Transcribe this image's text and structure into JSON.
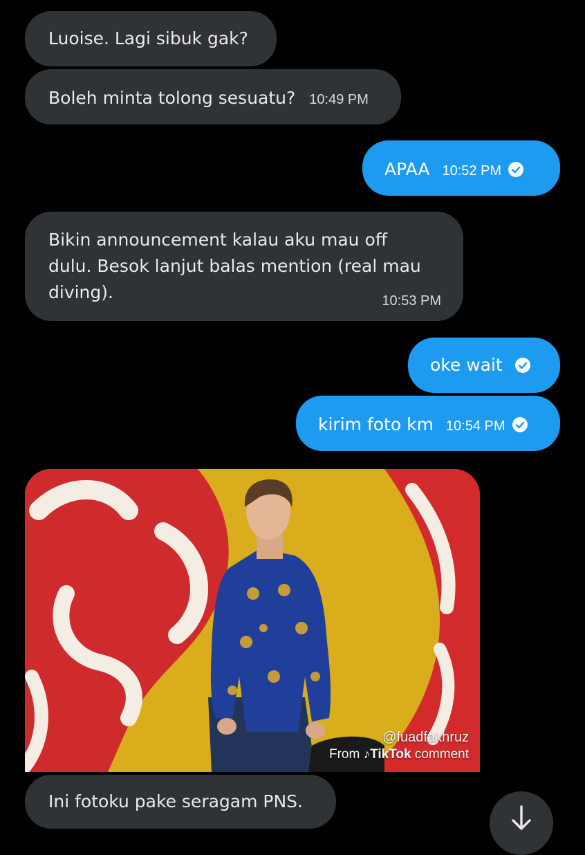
{
  "messages": [
    {
      "dir": "in",
      "text": "Luoise. Lagi sibuk gak?"
    },
    {
      "dir": "in",
      "text": "Boleh minta tolong sesuatu?",
      "time": "10:49 PM"
    },
    {
      "dir": "out",
      "text": "APAA",
      "time": "10:52 PM"
    },
    {
      "dir": "in",
      "lines": [
        "Bikin announcement kalau aku mau off",
        "dulu. Besok lanjut balas mention (real mau",
        "diving)."
      ],
      "time": "10:53 PM"
    },
    {
      "dir": "out",
      "text": "oke wait"
    },
    {
      "dir": "out",
      "text": "kirim foto km",
      "time": "10:54 PM"
    },
    {
      "dir": "in",
      "text": "Ini fotoku pake seragam PNS."
    }
  ],
  "image": {
    "watermark_handle": "@fuadfakhruz",
    "watermark_from": "From",
    "watermark_brand": "TikTok",
    "watermark_suffix": "comment"
  },
  "icons": {
    "read_receipt": "check-circle-icon",
    "scroll_down": "arrow-down-icon"
  },
  "colors": {
    "background": "#000000",
    "incoming_bubble": "#2f3336",
    "outgoing_bubble": "#1d9bf0"
  }
}
